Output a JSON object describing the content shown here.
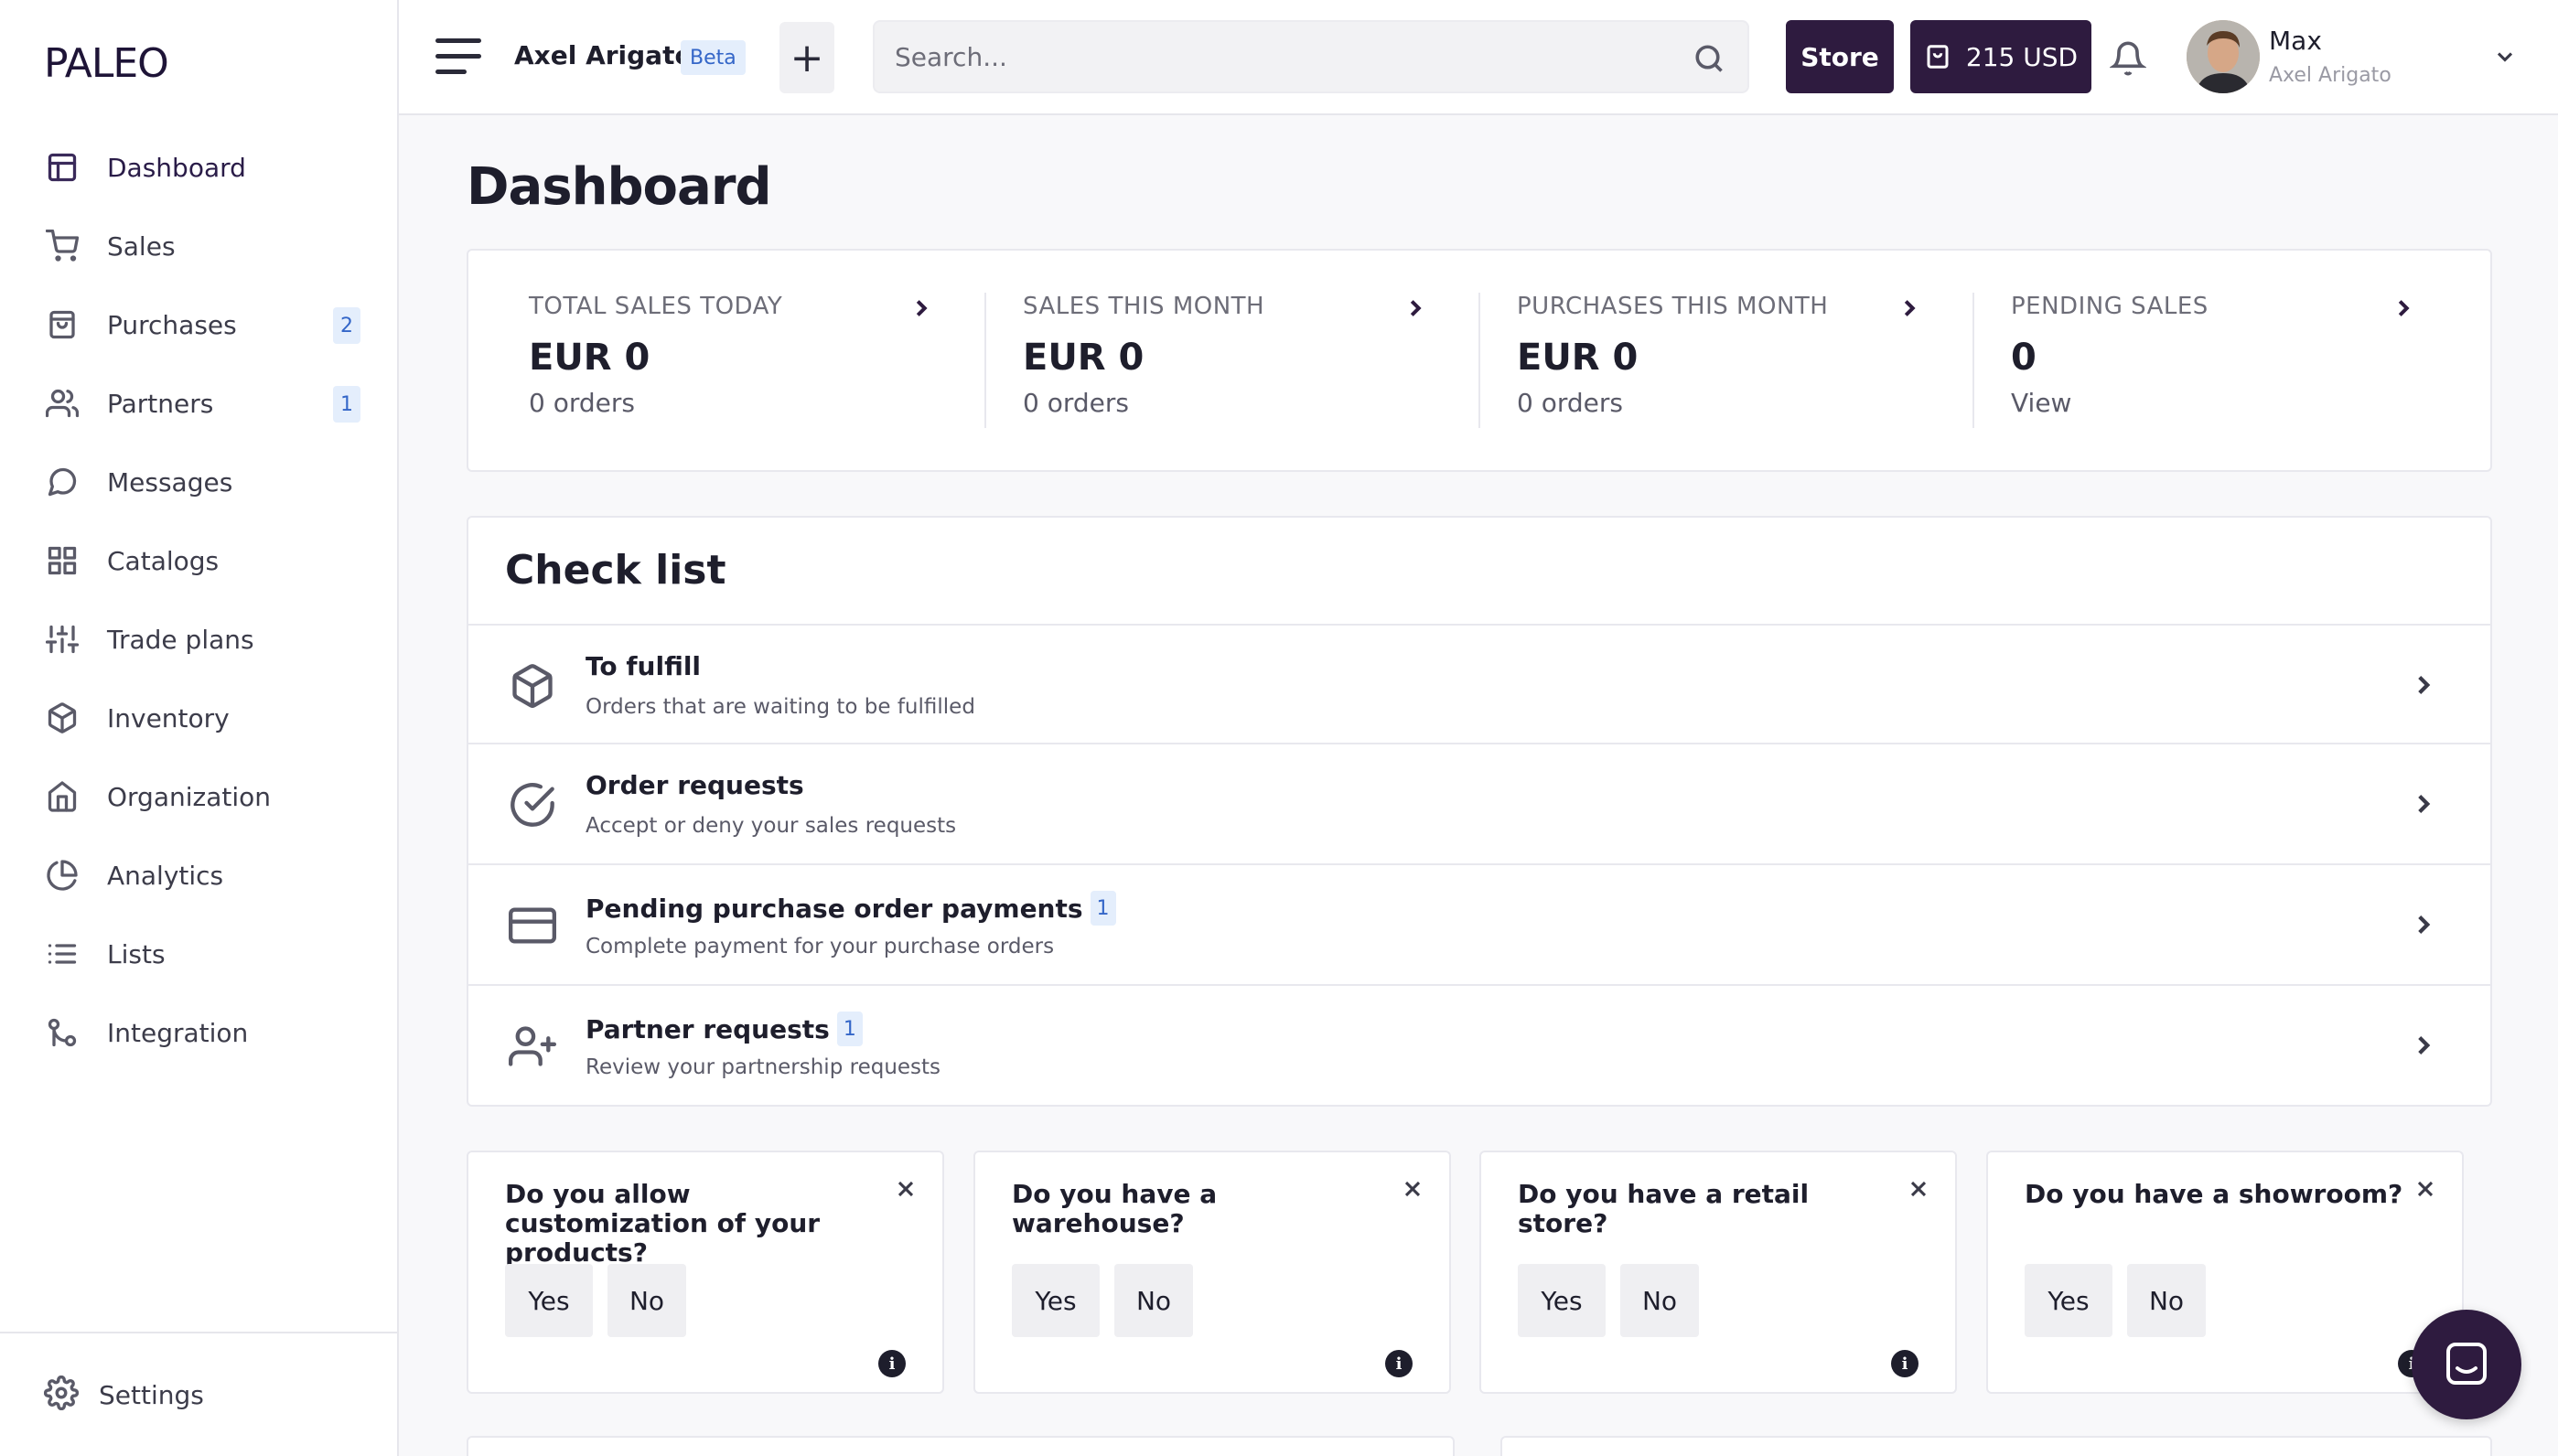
{
  "app": {
    "logo": "PALEO"
  },
  "sidebar": {
    "items": [
      {
        "label": "Dashboard",
        "icon": "dashboard-icon",
        "active": true,
        "badge": ""
      },
      {
        "label": "Sales",
        "icon": "cart-icon",
        "badge": ""
      },
      {
        "label": "Purchases",
        "icon": "shopping-bag-icon",
        "badge": "2"
      },
      {
        "label": "Partners",
        "icon": "users-icon",
        "badge": "1"
      },
      {
        "label": "Messages",
        "icon": "message-icon",
        "badge": ""
      },
      {
        "label": "Catalogs",
        "icon": "grid-icon",
        "badge": ""
      },
      {
        "label": "Trade plans",
        "icon": "sliders-icon",
        "badge": ""
      },
      {
        "label": "Inventory",
        "icon": "box-icon",
        "badge": ""
      },
      {
        "label": "Organization",
        "icon": "home-icon",
        "badge": ""
      },
      {
        "label": "Analytics",
        "icon": "pie-chart-icon",
        "badge": ""
      },
      {
        "label": "Lists",
        "icon": "list-icon",
        "badge": ""
      },
      {
        "label": "Integration",
        "icon": "git-merge-icon",
        "badge": ""
      }
    ],
    "settings_label": "Settings"
  },
  "header": {
    "org_name": "Axel Arigato",
    "beta_label": "Beta",
    "add_label": "+",
    "search_placeholder": "Search...",
    "store_label": "Store",
    "cart_label": "215 USD",
    "user_name": "Max",
    "user_org": "Axel Arigato"
  },
  "main": {
    "title": "Dashboard",
    "stats": [
      {
        "title": "TOTAL SALES TODAY",
        "value": "EUR 0",
        "sub": "0 orders"
      },
      {
        "title": "SALES THIS MONTH",
        "value": "EUR 0",
        "sub": "0 orders"
      },
      {
        "title": "PURCHASES THIS MONTH",
        "value": "EUR 0",
        "sub": "0 orders"
      },
      {
        "title": "PENDING SALES",
        "value": "0",
        "sub": "View"
      }
    ],
    "checklist": {
      "title": "Check list",
      "rows": [
        {
          "title": "To fulfill",
          "desc": "Orders that are waiting to be fulfilled",
          "badge": "",
          "icon": "package-icon"
        },
        {
          "title": "Order requests",
          "desc": "Accept or deny your sales requests",
          "badge": "",
          "icon": "check-circle-icon"
        },
        {
          "title": "Pending purchase order payments",
          "desc": "Complete payment for your purchase orders",
          "badge": "1",
          "icon": "credit-card-icon"
        },
        {
          "title": "Partner requests",
          "desc": "Review your partnership requests",
          "badge": "1",
          "icon": "user-plus-icon"
        }
      ]
    },
    "questions": [
      {
        "text": "Do you allow customization of your products?",
        "yes": "Yes",
        "no": "No"
      },
      {
        "text": "Do you have a warehouse?",
        "yes": "Yes",
        "no": "No"
      },
      {
        "text": "Do you have a retail store?",
        "yes": "Yes",
        "no": "No"
      },
      {
        "text": "Do you have a showroom?",
        "yes": "Yes",
        "no": "No"
      }
    ]
  },
  "colors": {
    "brand": "#2e1b3f",
    "badge_bg": "#e4eefc",
    "badge_text": "#3466c8"
  }
}
